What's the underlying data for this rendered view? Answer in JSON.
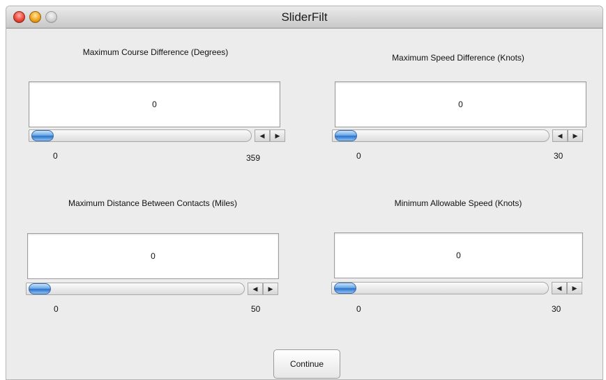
{
  "window": {
    "title": "SliderFilt"
  },
  "panels": [
    {
      "label": "Maximum Course Difference (Degrees)",
      "value": "0",
      "min": "0",
      "max": "359"
    },
    {
      "label": "Maximum Speed Difference (Knots)",
      "value": "0",
      "min": "0",
      "max": "30"
    },
    {
      "label": "Maximum Distance Between Contacts (Miles)",
      "value": "0",
      "min": "0",
      "max": "50"
    },
    {
      "label": "Minimum Allowable Speed (Knots)",
      "value": "0",
      "min": "0",
      "max": "30"
    }
  ],
  "icons": {
    "left_arrow": "◀",
    "right_arrow": "▶"
  },
  "footer": {
    "continue_label": "Continue"
  }
}
